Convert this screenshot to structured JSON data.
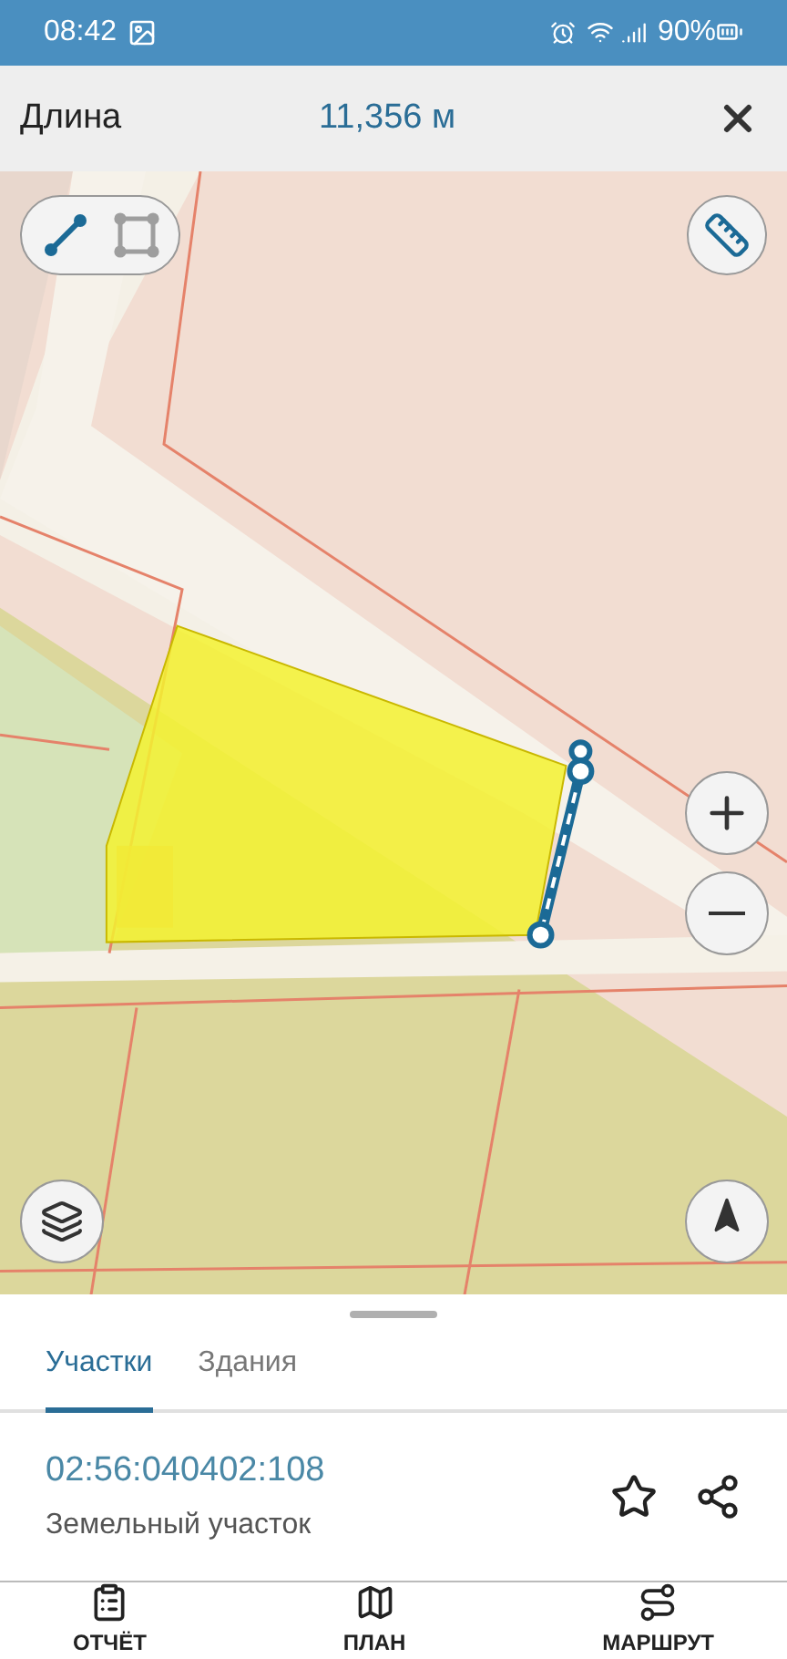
{
  "status_bar": {
    "time": "08:42",
    "battery": "90%"
  },
  "header": {
    "title": "Длина",
    "value": "11,356 м"
  },
  "draw_modes": [
    {
      "kind": "line",
      "selected": true
    },
    {
      "kind": "polygon",
      "selected": false
    }
  ],
  "tabs": [
    {
      "label": "Участки",
      "selected": true
    },
    {
      "label": "Здания",
      "selected": false
    }
  ],
  "parcel": {
    "number": "02:56:040402:108",
    "type": "Земельный участок"
  },
  "nav": [
    {
      "kind": "report",
      "label": "ОТЧЁТ"
    },
    {
      "kind": "plan",
      "label": "ПЛАН"
    },
    {
      "kind": "route",
      "label": "МАРШРУТ"
    }
  ]
}
